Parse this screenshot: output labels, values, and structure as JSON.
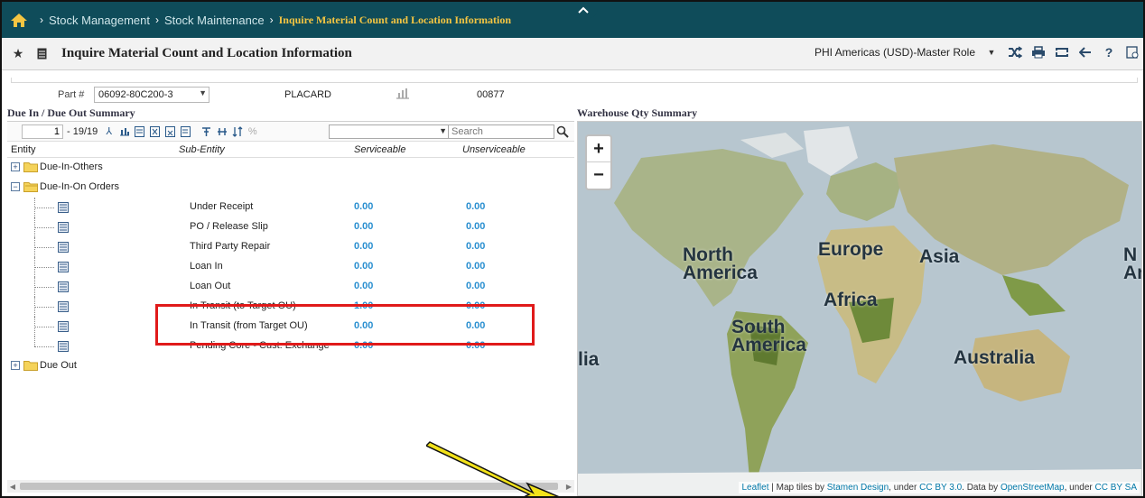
{
  "breadcrumb": {
    "items": [
      "Stock Management",
      "Stock Maintenance"
    ],
    "current": "Inquire Material Count and Location Information"
  },
  "titlebar": {
    "title": "Inquire Material Count and Location Information",
    "role": "PHI Americas (USD)-Master Role"
  },
  "part": {
    "label": "Part #",
    "number": "06092-80C200-3",
    "description": "PLACARD",
    "code": "00877"
  },
  "left_section_title": "Due In / Due Out Summary",
  "right_section_title": "Warehouse Qty Summary",
  "grid_toolbar": {
    "page": "1",
    "count": "- 19/19",
    "search_placeholder": "Search"
  },
  "grid_columns": {
    "entity": "Entity",
    "sub_entity": "Sub-Entity",
    "serviceable": "Serviceable",
    "unserviceable": "Unserviceable"
  },
  "tree": {
    "group1": "Due-In-Others",
    "group2": "Due-In-On Orders",
    "group3": "Due Out",
    "rows": [
      {
        "sub": "Under Receipt",
        "svc": "0.00",
        "unsvc": "0.00"
      },
      {
        "sub": "PO / Release Slip",
        "svc": "0.00",
        "unsvc": "0.00"
      },
      {
        "sub": "Third Party Repair",
        "svc": "0.00",
        "unsvc": "0.00"
      },
      {
        "sub": " Loan In",
        "svc": "0.00",
        "unsvc": "0.00"
      },
      {
        "sub": " Loan Out",
        "svc": "0.00",
        "unsvc": "0.00"
      },
      {
        "sub": "In Transit (to Target OU)",
        "svc": "1.00",
        "unsvc": "0.00"
      },
      {
        "sub": "In Transit (from Target OU)",
        "svc": "0.00",
        "unsvc": "0.00"
      },
      {
        "sub": "Pending Core - Cust. Exchange",
        "svc": "0.00",
        "unsvc": "0.00"
      }
    ]
  },
  "map": {
    "zoom_in": "+",
    "zoom_out": "−",
    "labels": {
      "north_america": "North America",
      "europe": "Europe",
      "asia": "Asia",
      "africa": "Africa",
      "south_america": "South America",
      "australia": "Australia",
      "edge_left": "lia",
      "edge_right": "N Am"
    },
    "attribution": {
      "leaflet": "Leaflet",
      "tiles_text": " | Map tiles by ",
      "stamen": "Stamen Design",
      "under1": ", under ",
      "ccby": "CC BY 3.0",
      "data_by": ". Data by ",
      "osm": "OpenStreetMap",
      "under2": ", under ",
      "ccbysa": "CC BY SA"
    }
  },
  "colors": {
    "header_bg": "#0f4c5a",
    "breadcrumb_active": "#f4c542",
    "value_blue": "#2a8fd0",
    "highlight_red": "#e01a1a",
    "callout_yellow": "#f2e21a"
  }
}
